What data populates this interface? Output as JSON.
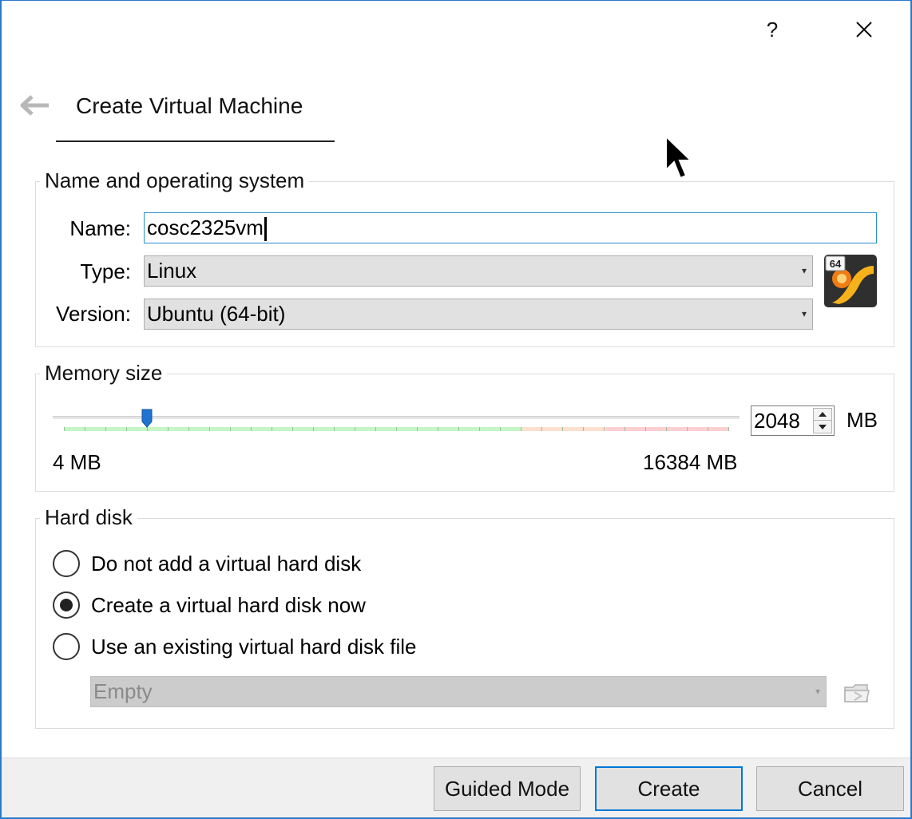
{
  "titlebar": {
    "help_label": "?",
    "close_label": "✕"
  },
  "header": {
    "title": "Create Virtual Machine"
  },
  "name_os": {
    "group_title": "Name and operating system",
    "name_label": "Name:",
    "name_value": "cosc2325vm",
    "type_label": "Type:",
    "type_value": "Linux",
    "version_label": "Version:",
    "version_value": "Ubuntu (64-bit)",
    "os_badge": "64"
  },
  "memory": {
    "group_title": "Memory size",
    "value": "2048",
    "unit": "MB",
    "min_label": "4 MB",
    "max_label": "16384 MB",
    "slider_fraction": 0.125
  },
  "hard_disk": {
    "group_title": "Hard disk",
    "options": [
      {
        "label": "Do not add a virtual hard disk",
        "checked": false
      },
      {
        "label": "Create a virtual hard disk now",
        "checked": true
      },
      {
        "label": "Use an existing virtual hard disk file",
        "checked": false
      }
    ],
    "existing_file_value": "Empty"
  },
  "footer": {
    "guided_mode_label": "Guided Mode",
    "create_label": "Create",
    "cancel_label": "Cancel"
  },
  "colors": {
    "accent": "#0078d7",
    "focus_border": "#2b8fc9",
    "window_border": "#2b79c9"
  },
  "icons": [
    "back-arrow-icon",
    "help-icon",
    "close-icon",
    "linux-64-icon",
    "dropdown-arrow-icon",
    "folder-icon",
    "mouse-cursor-icon"
  ]
}
